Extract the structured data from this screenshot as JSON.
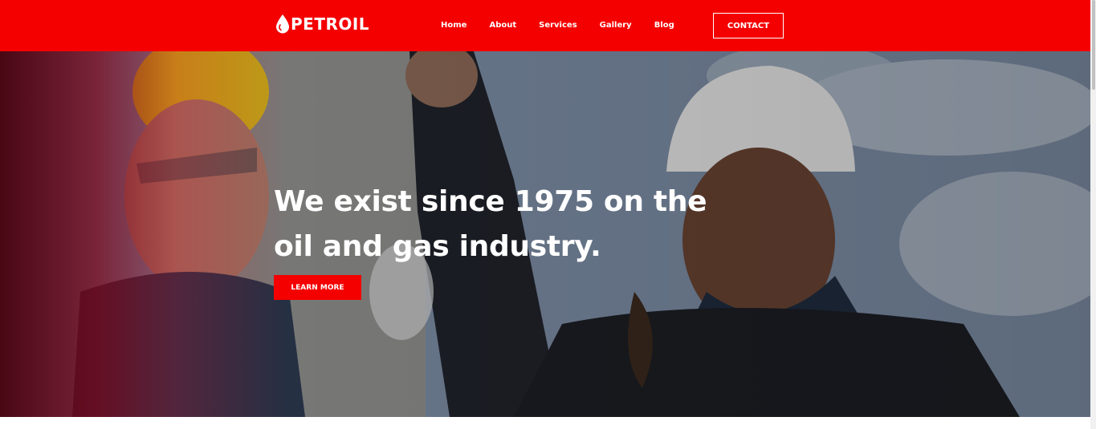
{
  "brand": {
    "name": "PETROIL",
    "accent_color": "#f40000"
  },
  "nav": {
    "items": [
      {
        "label": "Home"
      },
      {
        "label": "About"
      },
      {
        "label": "Services"
      },
      {
        "label": "Gallery"
      },
      {
        "label": "Blog"
      }
    ],
    "contact_label": "CONTACT"
  },
  "hero": {
    "title_line1": "We exist since 1975 on the",
    "title_line2": "oil and gas industry.",
    "cta_label": "LEARN MORE"
  },
  "icons": {
    "logo": "oil-drop-icon"
  }
}
